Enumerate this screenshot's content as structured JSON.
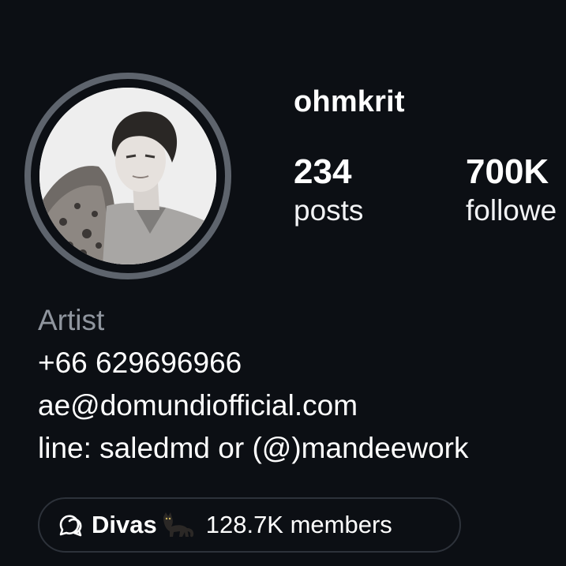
{
  "profile": {
    "username": "ohmkrit",
    "avatar_icon": "profile-photo",
    "ring_color": "#5e646d"
  },
  "stats": {
    "posts": {
      "value": "234",
      "label": "posts"
    },
    "followers": {
      "value": "700K",
      "label": "followe"
    }
  },
  "bio": {
    "category": "Artist",
    "phone": "+66 629696966",
    "email": "ae@domundiofficial.com",
    "line": "line: saledmd or (@)mandeework"
  },
  "community": {
    "icon": "community-chat-icon",
    "name": "Divas",
    "emoji_icon": "black-cat-icon",
    "members": "128.7K members"
  },
  "colors": {
    "background": "#0c0f14",
    "muted_text": "#8f959e",
    "chip_border": "#2d323a"
  }
}
